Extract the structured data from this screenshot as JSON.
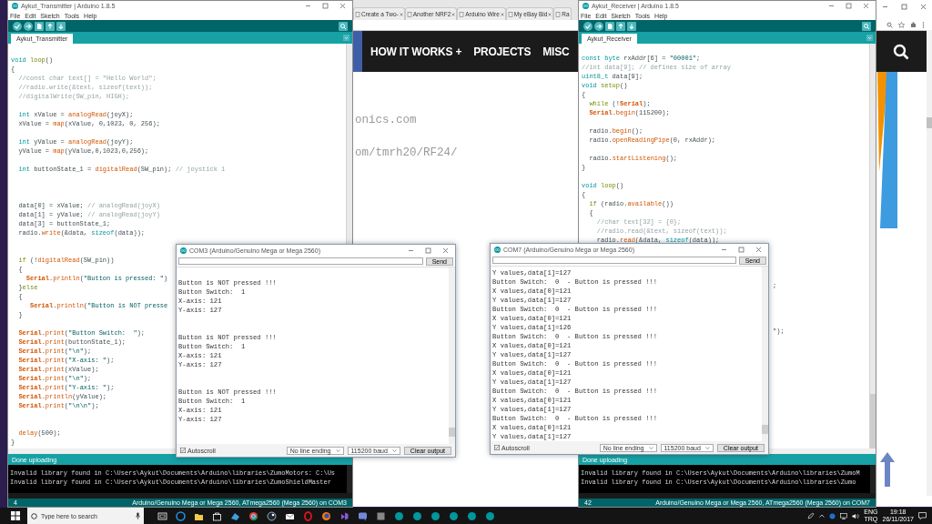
{
  "browser": {
    "tabs": [
      {
        "label": "Create a Two-",
        "selected": false
      },
      {
        "label": "Another NRF2",
        "selected": false
      },
      {
        "label": "Arduino Wire",
        "selected": false
      },
      {
        "label": "My eBay Bid",
        "selected": false
      },
      {
        "label": "Ra",
        "selected": false
      }
    ],
    "nav": [
      "HOW IT WORKS +",
      "PROJECTS",
      "MISC"
    ],
    "body_lines": [
      "onics.com",
      "om/tmrh20/RF24/"
    ]
  },
  "editors": [
    {
      "title": "Aykut_Transmitter | Arduino 1.8.5",
      "menu": [
        "File",
        "Edit",
        "Sketch",
        "Tools",
        "Help"
      ],
      "tab": "Aykut_Transmitter",
      "code": [
        {
          "kind": "code",
          "tokens": [
            {
              "kind": "keyword",
              "text": "void "
            },
            {
              "kind": "control",
              "text": "loop"
            },
            {
              "kind": "plain",
              "text": "()"
            }
          ]
        },
        {
          "kind": "code",
          "tokens": [
            {
              "kind": "plain",
              "text": "{"
            }
          ]
        },
        {
          "kind": "code",
          "tokens": [
            {
              "kind": "comment",
              "text": "  //const char text[] = \"Hello World\";"
            }
          ]
        },
        {
          "kind": "code",
          "tokens": [
            {
              "kind": "comment",
              "text": "  //radio.write(&text, sizeof(text));"
            }
          ]
        },
        {
          "kind": "code",
          "tokens": [
            {
              "kind": "comment",
              "text": "  //digitalWrite(SW_pin, HIGH);"
            }
          ]
        },
        {
          "kind": "blank"
        },
        {
          "kind": "code",
          "tokens": [
            {
              "kind": "keyword",
              "text": "  int"
            },
            {
              "kind": "plain",
              "text": " xValue = "
            },
            {
              "kind": "function",
              "text": "analogRead"
            },
            {
              "kind": "plain",
              "text": "(joyX);"
            }
          ]
        },
        {
          "kind": "code",
          "tokens": [
            {
              "kind": "plain",
              "text": "  xValue = "
            },
            {
              "kind": "function",
              "text": "map"
            },
            {
              "kind": "plain",
              "text": "(xValue, 0,1023, 0, 256);"
            }
          ]
        },
        {
          "kind": "blank"
        },
        {
          "kind": "code",
          "tokens": [
            {
              "kind": "keyword",
              "text": "  int"
            },
            {
              "kind": "plain",
              "text": " yValue = "
            },
            {
              "kind": "function",
              "text": "analogRead"
            },
            {
              "kind": "plain",
              "text": "(joyY);"
            }
          ]
        },
        {
          "kind": "code",
          "tokens": [
            {
              "kind": "plain",
              "text": "  yValue = "
            },
            {
              "kind": "function",
              "text": "map"
            },
            {
              "kind": "plain",
              "text": "(yValue,0,1023,0,256);"
            }
          ]
        },
        {
          "kind": "blank"
        },
        {
          "kind": "code",
          "tokens": [
            {
              "kind": "keyword",
              "text": "  int"
            },
            {
              "kind": "plain",
              "text": " buttonState_1 = "
            },
            {
              "kind": "function",
              "text": "digitalRead"
            },
            {
              "kind": "plain",
              "text": "(SW_pin); "
            },
            {
              "kind": "comment",
              "text": "// joystick 1"
            }
          ]
        },
        {
          "kind": "blank"
        },
        {
          "kind": "blank"
        },
        {
          "kind": "blank"
        },
        {
          "kind": "code",
          "tokens": [
            {
              "kind": "plain",
              "text": "  data[0] = xValue; "
            },
            {
              "kind": "comment",
              "text": "// analogRead(joyX)"
            }
          ]
        },
        {
          "kind": "code",
          "tokens": [
            {
              "kind": "plain",
              "text": "  data[1] = yValue; "
            },
            {
              "kind": "comment",
              "text": "// analogRead(joyY)"
            }
          ]
        },
        {
          "kind": "code",
          "tokens": [
            {
              "kind": "plain",
              "text": "  data[3] = buttonState_1;"
            }
          ]
        },
        {
          "kind": "code",
          "tokens": [
            {
              "kind": "plain",
              "text": "  radio."
            },
            {
              "kind": "function",
              "text": "write"
            },
            {
              "kind": "plain",
              "text": "(&data, "
            },
            {
              "kind": "keyword",
              "text": "sizeof"
            },
            {
              "kind": "plain",
              "text": "(data));"
            }
          ]
        },
        {
          "kind": "blank"
        },
        {
          "kind": "blank"
        },
        {
          "kind": "code",
          "tokens": [
            {
              "kind": "control",
              "text": "  if"
            },
            {
              "kind": "plain",
              "text": " (!"
            },
            {
              "kind": "function",
              "text": "digitalRead"
            },
            {
              "kind": "plain",
              "text": "(SW_pin))"
            }
          ]
        },
        {
          "kind": "code",
          "tokens": [
            {
              "kind": "plain",
              "text": "  {"
            }
          ]
        },
        {
          "kind": "code",
          "tokens": [
            {
              "kind": "serial",
              "text": "    Serial"
            },
            {
              "kind": "plain",
              "text": "."
            },
            {
              "kind": "function",
              "text": "println"
            },
            {
              "kind": "plain",
              "text": "("
            },
            {
              "kind": "string",
              "text": "\"Button is pressed: \""
            },
            {
              "kind": "plain",
              "text": ")"
            }
          ]
        },
        {
          "kind": "code",
          "tokens": [
            {
              "kind": "plain",
              "text": "  }"
            },
            {
              "kind": "control",
              "text": "else"
            }
          ]
        },
        {
          "kind": "code",
          "tokens": [
            {
              "kind": "plain",
              "text": "  {"
            }
          ]
        },
        {
          "kind": "code",
          "tokens": [
            {
              "kind": "serial",
              "text": "     Serial"
            },
            {
              "kind": "plain",
              "text": "."
            },
            {
              "kind": "function",
              "text": "println"
            },
            {
              "kind": "plain",
              "text": "("
            },
            {
              "kind": "string",
              "text": "\"Button is NOT presse"
            }
          ]
        },
        {
          "kind": "code",
          "tokens": [
            {
              "kind": "plain",
              "text": "  }"
            }
          ]
        },
        {
          "kind": "blank"
        },
        {
          "kind": "code",
          "tokens": [
            {
              "kind": "serial",
              "text": "  Serial"
            },
            {
              "kind": "plain",
              "text": "."
            },
            {
              "kind": "function",
              "text": "print"
            },
            {
              "kind": "plain",
              "text": "("
            },
            {
              "kind": "string",
              "text": "\"Button Switch:  \""
            },
            {
              "kind": "plain",
              "text": ");"
            }
          ]
        },
        {
          "kind": "code",
          "tokens": [
            {
              "kind": "serial",
              "text": "  Serial"
            },
            {
              "kind": "plain",
              "text": "."
            },
            {
              "kind": "function",
              "text": "print"
            },
            {
              "kind": "plain",
              "text": "(buttonState_1);"
            }
          ]
        },
        {
          "kind": "code",
          "tokens": [
            {
              "kind": "serial",
              "text": "  Serial"
            },
            {
              "kind": "plain",
              "text": "."
            },
            {
              "kind": "function",
              "text": "print"
            },
            {
              "kind": "plain",
              "text": "("
            },
            {
              "kind": "string",
              "text": "\"\\n\""
            },
            {
              "kind": "plain",
              "text": ");"
            }
          ]
        },
        {
          "kind": "code",
          "tokens": [
            {
              "kind": "serial",
              "text": "  Serial"
            },
            {
              "kind": "plain",
              "text": "."
            },
            {
              "kind": "function",
              "text": "print"
            },
            {
              "kind": "plain",
              "text": "("
            },
            {
              "kind": "string",
              "text": "\"X-axis: \""
            },
            {
              "kind": "plain",
              "text": ");"
            }
          ]
        },
        {
          "kind": "code",
          "tokens": [
            {
              "kind": "serial",
              "text": "  Serial"
            },
            {
              "kind": "plain",
              "text": "."
            },
            {
              "kind": "function",
              "text": "print"
            },
            {
              "kind": "plain",
              "text": "(xValue);"
            }
          ]
        },
        {
          "kind": "code",
          "tokens": [
            {
              "kind": "serial",
              "text": "  Serial"
            },
            {
              "kind": "plain",
              "text": "."
            },
            {
              "kind": "function",
              "text": "print"
            },
            {
              "kind": "plain",
              "text": "("
            },
            {
              "kind": "string",
              "text": "\"\\n\""
            },
            {
              "kind": "plain",
              "text": ");"
            }
          ]
        },
        {
          "kind": "code",
          "tokens": [
            {
              "kind": "serial",
              "text": "  Serial"
            },
            {
              "kind": "plain",
              "text": "."
            },
            {
              "kind": "function",
              "text": "print"
            },
            {
              "kind": "plain",
              "text": "("
            },
            {
              "kind": "string",
              "text": "\"Y-axis: \""
            },
            {
              "kind": "plain",
              "text": ");"
            }
          ]
        },
        {
          "kind": "code",
          "tokens": [
            {
              "kind": "serial",
              "text": "  Serial"
            },
            {
              "kind": "plain",
              "text": "."
            },
            {
              "kind": "function",
              "text": "println"
            },
            {
              "kind": "plain",
              "text": "(yValue);"
            }
          ]
        },
        {
          "kind": "code",
          "tokens": [
            {
              "kind": "serial",
              "text": "  Serial"
            },
            {
              "kind": "plain",
              "text": "."
            },
            {
              "kind": "function",
              "text": "print"
            },
            {
              "kind": "plain",
              "text": "("
            },
            {
              "kind": "string",
              "text": "\"\\n\\n\""
            },
            {
              "kind": "plain",
              "text": ");"
            }
          ]
        },
        {
          "kind": "blank"
        },
        {
          "kind": "blank"
        },
        {
          "kind": "code",
          "tokens": [
            {
              "kind": "function",
              "text": "  delay"
            },
            {
              "kind": "plain",
              "text": "(500);"
            }
          ]
        },
        {
          "kind": "code",
          "tokens": [
            {
              "kind": "plain",
              "text": "}"
            }
          ]
        }
      ],
      "status": "Done uploading",
      "console": [
        "Invalid library found in C:\\Users\\Aykut\\Documents\\Arduino\\libraries\\ZumoMotors: C:\\Us",
        "Invalid library found in C:\\Users\\Aykut\\Documents\\Arduino\\libraries\\ZumoShieldMaster"
      ],
      "line_number": "4",
      "board": "Arduino/Genuino Mega or Mega 2560, ATmega2560 (Mega 2560) on COM3"
    },
    {
      "title": "Aykut_Receiver | Arduino 1.8.5",
      "menu": [
        "File",
        "Edit",
        "Sketch",
        "Tools",
        "Help"
      ],
      "tab": "Aykut_Receiver",
      "code": [
        {
          "kind": "code",
          "tokens": [
            {
              "kind": "keyword",
              "text": "const byte"
            },
            {
              "kind": "plain",
              "text": " rxAddr[6] = "
            },
            {
              "kind": "string",
              "text": "\"00001\""
            },
            {
              "kind": "plain",
              "text": ";"
            }
          ]
        },
        {
          "kind": "code",
          "tokens": [
            {
              "kind": "comment",
              "text": "//int data[9]; // defines size of array"
            }
          ]
        },
        {
          "kind": "code",
          "tokens": [
            {
              "kind": "keyword",
              "text": "uint8_t"
            },
            {
              "kind": "plain",
              "text": " data[9];"
            }
          ]
        },
        {
          "kind": "code",
          "tokens": [
            {
              "kind": "keyword",
              "text": "void "
            },
            {
              "kind": "control",
              "text": "setup"
            },
            {
              "kind": "plain",
              "text": "()"
            }
          ]
        },
        {
          "kind": "code",
          "tokens": [
            {
              "kind": "plain",
              "text": "{"
            }
          ]
        },
        {
          "kind": "code",
          "tokens": [
            {
              "kind": "control",
              "text": "  while"
            },
            {
              "kind": "plain",
              "text": " (!"
            },
            {
              "kind": "serial",
              "text": "Serial"
            },
            {
              "kind": "plain",
              "text": ");"
            }
          ]
        },
        {
          "kind": "code",
          "tokens": [
            {
              "kind": "serial",
              "text": "  Serial"
            },
            {
              "kind": "plain",
              "text": "."
            },
            {
              "kind": "function",
              "text": "begin"
            },
            {
              "kind": "plain",
              "text": "(115200);"
            }
          ]
        },
        {
          "kind": "blank"
        },
        {
          "kind": "code",
          "tokens": [
            {
              "kind": "plain",
              "text": "  radio."
            },
            {
              "kind": "function",
              "text": "begin"
            },
            {
              "kind": "plain",
              "text": "();"
            }
          ]
        },
        {
          "kind": "code",
          "tokens": [
            {
              "kind": "plain",
              "text": "  radio."
            },
            {
              "kind": "function",
              "text": "openReadingPipe"
            },
            {
              "kind": "plain",
              "text": "(0, rxAddr);"
            }
          ]
        },
        {
          "kind": "blank"
        },
        {
          "kind": "code",
          "tokens": [
            {
              "kind": "plain",
              "text": "  radio."
            },
            {
              "kind": "function",
              "text": "startListening"
            },
            {
              "kind": "plain",
              "text": "();"
            }
          ]
        },
        {
          "kind": "code",
          "tokens": [
            {
              "kind": "plain",
              "text": "}"
            }
          ]
        },
        {
          "kind": "blank"
        },
        {
          "kind": "code",
          "tokens": [
            {
              "kind": "keyword",
              "text": "void "
            },
            {
              "kind": "control",
              "text": "loop"
            },
            {
              "kind": "plain",
              "text": "()"
            }
          ]
        },
        {
          "kind": "code",
          "tokens": [
            {
              "kind": "plain",
              "text": "{"
            }
          ]
        },
        {
          "kind": "code",
          "tokens": [
            {
              "kind": "control",
              "text": "  if"
            },
            {
              "kind": "plain",
              "text": " (radio."
            },
            {
              "kind": "function",
              "text": "available"
            },
            {
              "kind": "plain",
              "text": "())"
            }
          ]
        },
        {
          "kind": "code",
          "tokens": [
            {
              "kind": "plain",
              "text": "  {"
            }
          ]
        },
        {
          "kind": "code",
          "tokens": [
            {
              "kind": "comment",
              "text": "    //char text[32] = {0};"
            }
          ]
        },
        {
          "kind": "code",
          "tokens": [
            {
              "kind": "comment",
              "text": "    //radio.read(&text, sizeof(text));"
            }
          ]
        },
        {
          "kind": "code",
          "tokens": [
            {
              "kind": "plain",
              "text": "    radio."
            },
            {
              "kind": "function",
              "text": "read"
            },
            {
              "kind": "plain",
              "text": "(&data, "
            },
            {
              "kind": "keyword",
              "text": "sizeof"
            },
            {
              "kind": "plain",
              "text": "(data));"
            }
          ]
        },
        {
          "kind": "blank"
        },
        {
          "kind": "blank"
        },
        {
          "kind": "blank"
        },
        {
          "kind": "blank"
        },
        {
          "kind": "code",
          "tokens": [
            {
              "kind": "plain",
              "text": "                                                  ;"
            }
          ]
        },
        {
          "kind": "blank"
        },
        {
          "kind": "blank"
        },
        {
          "kind": "blank"
        },
        {
          "kind": "blank"
        },
        {
          "kind": "code",
          "tokens": [
            {
              "kind": "plain",
              "text": "                                                  \");"
            }
          ]
        }
      ],
      "status": "Done uploading",
      "console": [
        "Invalid library found in C:\\Users\\Aykut\\Documents\\Arduino\\libraries\\ZumoM",
        "Invalid library found in C:\\Users\\Aykut\\Documents\\Arduino\\libraries\\Zumo"
      ],
      "line_number": "42",
      "board": "Arduino/Genuino Mega or Mega 2560, ATmega2560 (Mega 2560) on COM7"
    }
  ],
  "monitors": [
    {
      "title": "COM3 (Arduino/Genuino Mega or Mega 2560)",
      "send": "Send",
      "output": [
        [
          "Button is NOT pressed !!!",
          "Button Switch:  1",
          "X-axis: 121",
          "Y-axis: 127"
        ],
        [
          "Button is NOT pressed !!!",
          "Button Switch:  1",
          "X-axis: 121",
          "Y-axis: 127"
        ],
        [
          "Button is NOT pressed !!!",
          "Button Switch:  1",
          "X-axis: 121",
          "Y-axis: 127"
        ]
      ],
      "autoscroll": {
        "label": "Autoscroll",
        "checked": true
      },
      "line_ending": "No line ending",
      "baud": "115200 baud",
      "clear": "Clear output"
    },
    {
      "title": "COM7 (Arduino/Genuino Mega or Mega 2560)",
      "send": "Send",
      "output": [
        [
          "Y values,data[1]=127",
          "Button Switch:  0  - Button is pressed !!!",
          "X values,data[0]=121",
          "Y values,data[1]=127",
          "Button Switch:  0  - Button is pressed !!!",
          "X values,data[0]=121",
          "Y values,data[1]=126",
          "Button Switch:  0  - Button is pressed !!!",
          "X values,data[0]=121",
          "Y values,data[1]=127",
          "Button Switch:  0  - Button is pressed !!!",
          "X values,data[0]=121",
          "Y values,data[1]=127",
          "Button Switch:  0  - Button is pressed !!!",
          "X values,data[0]=121",
          "Y values,data[1]=127",
          "Button Switch:  0  - Button is pressed !!!",
          "X values,data[0]=121",
          "Y values,data[1]=127"
        ]
      ],
      "autoscroll": {
        "label": "Autoscroll",
        "checked": true
      },
      "line_ending": "No line ending",
      "baud": "115200 baud",
      "clear": "Clear output"
    }
  ],
  "taskbar": {
    "search_placeholder": "Type here to search",
    "language": "ENG",
    "layout": "TRQ",
    "time": "19:18",
    "date": "26/11/2017"
  }
}
